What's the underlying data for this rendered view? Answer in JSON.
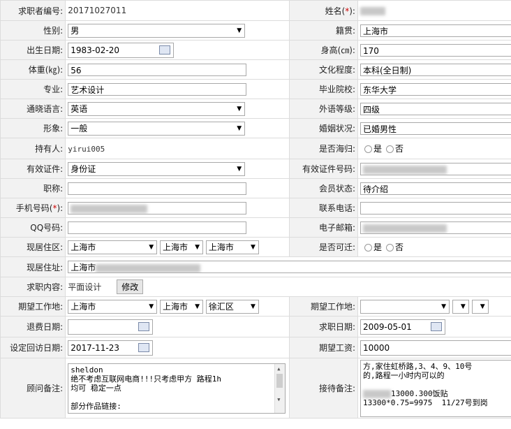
{
  "form": {
    "seeker_no_label": "求职者编号:",
    "seeker_no": "20171027011",
    "name_label": "姓名(",
    "name_label_star": "*",
    "name_label_end": "):",
    "gender_label": "性别:",
    "gender": "男",
    "native_label": "籍贯:",
    "native": "上海市",
    "birth_label": "出生日期:",
    "birth": "1983-02-20",
    "height_label": "身高(㎝):",
    "height": "170",
    "weight_label": "体重(㎏):",
    "weight": "56",
    "edu_label": "文化程度:",
    "edu": "本科(全日制)",
    "major_label": "专业:",
    "major": "艺术设计",
    "school_label": "毕业院校:",
    "school": "东华大学",
    "lang_label": "通晓语言:",
    "lang": "英语",
    "lang_level_label": "外语等级:",
    "lang_level": "四级",
    "image_label": "形象:",
    "image": "一般",
    "marital_label": "婚姻状况:",
    "marital": "已婚男性",
    "holder_label": "持有人:",
    "holder": "yirui005",
    "returnee_label": "是否海归:",
    "yes": "是",
    "no": "否",
    "id_type_label": "有效证件:",
    "id_type": "身份证",
    "id_no_label": "有效证件号码:",
    "title_label": "职称:",
    "member_status_label": "会员状态:",
    "member_status": "待介绍",
    "mobile_label": "手机号码(",
    "mobile_star": "*",
    "mobile_label_end": "):",
    "contact_label": "联系电话:",
    "qq_label": "QQ号码:",
    "email_label": "电子邮箱:",
    "residence_label": "现居住区:",
    "res_province": "上海市",
    "res_city": "上海市",
    "res_district": "上海市",
    "relocate_label": "是否可迁:",
    "address_label": "现居住址:",
    "address_prefix": "上海市",
    "job_content_label": "求职内容:",
    "job_content": "平面设计",
    "modify_button": "修改",
    "expect_loc_label": "期望工作地:",
    "exp_province": "上海市",
    "exp_city": "上海市",
    "exp_district": "徐汇区",
    "expect_loc_label2": "期望工作地:",
    "refund_label": "退费日期:",
    "apply_date_label": "求职日期:",
    "apply_date": "2009-05-01",
    "revisit_label": "设定回访日期:",
    "revisit_date": "2017-11-23",
    "salary_label": "期望工资:",
    "salary": "10000",
    "advisor_note_label": "顾问备注:",
    "advisor_note": "sheldon\n绝不考虑互联网电商!!!只考虑甲方 路程1h\n均可 稳定一点\n\n部分作品链接:",
    "reception_note_label": "接待备注:",
    "reception_note_line1": "方,家住虹桥路,3、4、9、10号",
    "reception_note_line2": "的,路程一小时内可以的",
    "reception_note_line3": "",
    "reception_note_line4": "13000.300饭贴",
    "reception_note_line5": "13300*0.75=9975  11/27号到岗"
  }
}
